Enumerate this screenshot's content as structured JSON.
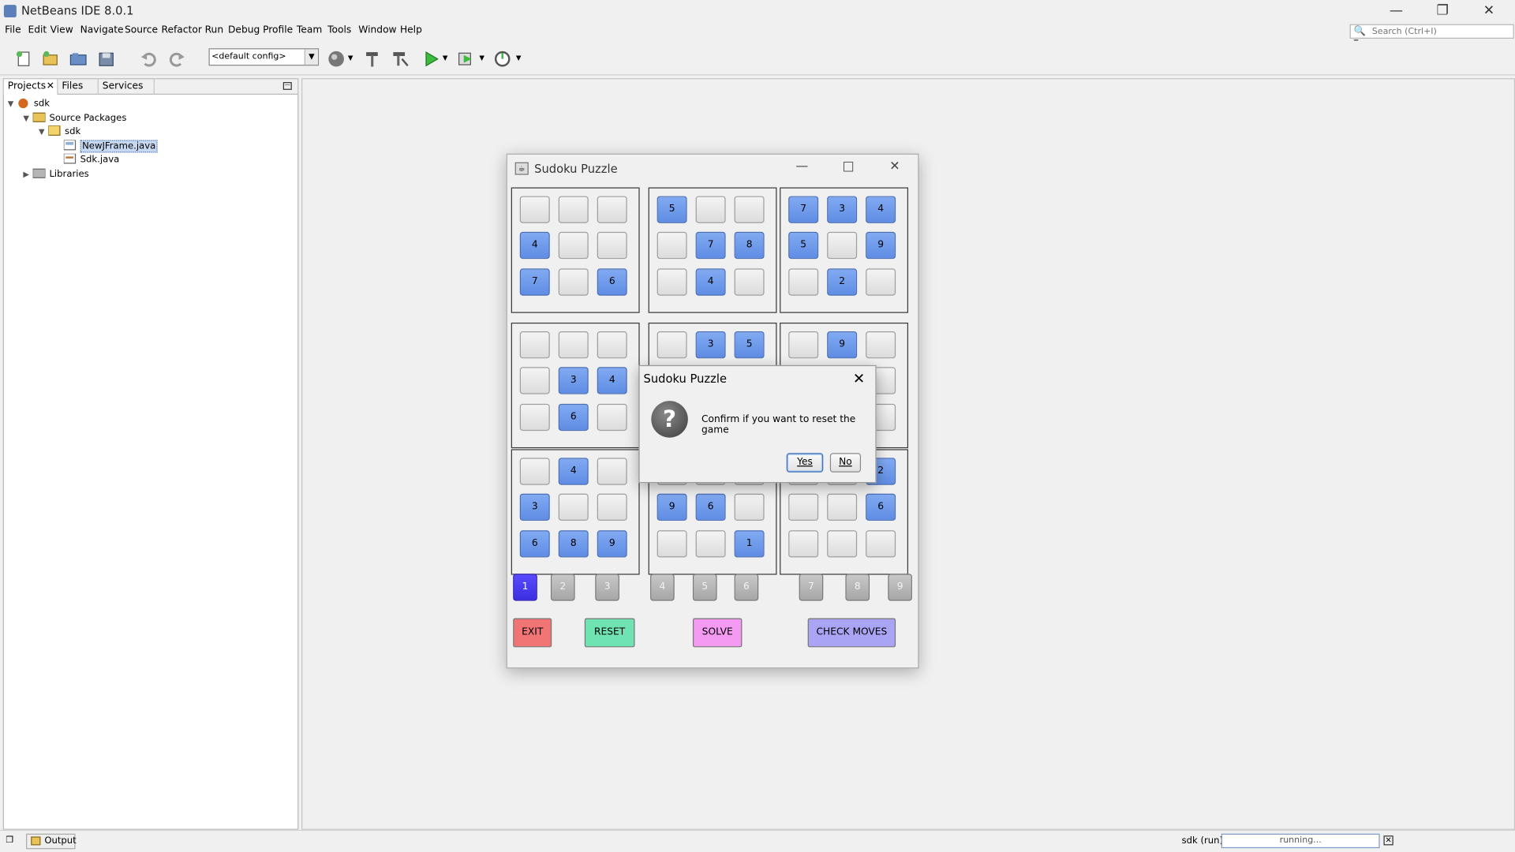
{
  "window": {
    "title": "NetBeans IDE 8.0.1"
  },
  "menu": [
    "File",
    "Edit",
    "View",
    "Navigate",
    "Source",
    "Refactor",
    "Run",
    "Debug",
    "Profile",
    "Team",
    "Tools",
    "Window",
    "Help"
  ],
  "search": {
    "placeholder": "Search (Ctrl+I)"
  },
  "toolbar": {
    "config": "<default config>"
  },
  "projects_panel": {
    "tabs": [
      "Projects",
      "Files",
      "Services"
    ],
    "tree": [
      {
        "label": "sdk",
        "icon": "project-icon",
        "level": 0
      },
      {
        "label": "Source Packages",
        "icon": "source-folder-icon",
        "level": 1
      },
      {
        "label": "sdk",
        "icon": "package-icon",
        "level": 2
      },
      {
        "label": "NewJFrame.java",
        "icon": "form-file-icon",
        "level": 3,
        "selected": true
      },
      {
        "label": "Sdk.java",
        "icon": "java-file-icon",
        "level": 3
      },
      {
        "label": "Libraries",
        "icon": "libraries-icon",
        "level": 1
      }
    ]
  },
  "statusbar": {
    "output_label": "Output",
    "run_label": "sdk (run)",
    "progress_text": "running..."
  },
  "sudoku": {
    "title": "Sudoku Puzzle",
    "boxes": [
      [
        "",
        "",
        "",
        "4",
        "",
        "",
        "7",
        "",
        "6"
      ],
      [
        "5",
        "",
        "",
        "",
        "7",
        "8",
        "",
        "4",
        ""
      ],
      [
        "7",
        "3",
        "4",
        "5",
        "",
        "9",
        "",
        "2",
        ""
      ],
      [
        "",
        "",
        "",
        "",
        "3",
        "4",
        "",
        "6",
        ""
      ],
      [
        "",
        "3",
        "5",
        "",
        "",
        "",
        "",
        "",
        ""
      ],
      [
        "",
        "9",
        "",
        "",
        "",
        "",
        "",
        "",
        ""
      ],
      [
        "",
        "4",
        "",
        "3",
        "",
        "",
        "6",
        "8",
        "9"
      ],
      [
        "",
        "",
        "",
        "9",
        "6",
        "",
        "",
        "",
        "1"
      ],
      [
        "",
        "",
        "2",
        "",
        "",
        "6",
        "",
        "",
        ""
      ]
    ],
    "number_buttons": [
      "1",
      "2",
      "3",
      "4",
      "5",
      "6",
      "7",
      "8",
      "9"
    ],
    "selected_number": "1",
    "actions": {
      "exit": "EXIT",
      "reset": "RESET",
      "solve": "SOLVE",
      "check": "CHECK MOVES"
    },
    "colors": {
      "filled_cell": "#6b96ea",
      "selected_number": "#4a3cf2",
      "exit": "#f27575",
      "reset": "#6fe3b2",
      "solve": "#f59af2",
      "check": "#a9a4f4"
    }
  },
  "dialog": {
    "title": "Sudoku Puzzle",
    "message": "Confirm if you want to reset the game",
    "yes": "Yes",
    "no": "No"
  }
}
